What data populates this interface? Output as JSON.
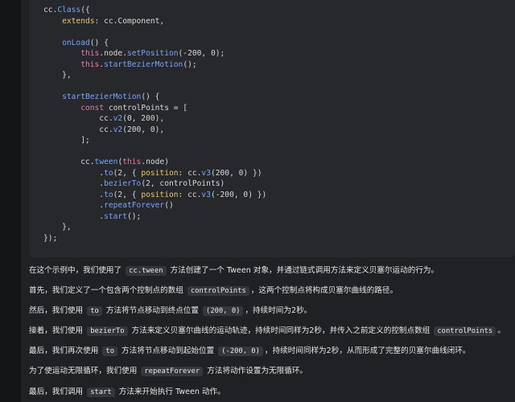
{
  "code": {
    "lines": [
      [
        {
          "t": "cc.",
          "c": "plain"
        },
        {
          "t": "Class",
          "c": "fn"
        },
        {
          "t": "({",
          "c": "plain"
        }
      ],
      [
        {
          "t": "    ",
          "c": "plain"
        },
        {
          "t": "extends",
          "c": "prop"
        },
        {
          "t": ": cc.Component,",
          "c": "plain"
        }
      ],
      [
        {
          "t": "",
          "c": "plain"
        }
      ],
      [
        {
          "t": "    ",
          "c": "plain"
        },
        {
          "t": "onLoad",
          "c": "fn"
        },
        {
          "t": "() {",
          "c": "plain"
        }
      ],
      [
        {
          "t": "        ",
          "c": "plain"
        },
        {
          "t": "this",
          "c": "kw"
        },
        {
          "t": ".node.",
          "c": "plain"
        },
        {
          "t": "setPosition",
          "c": "fn"
        },
        {
          "t": "(-200, 0);",
          "c": "plain"
        }
      ],
      [
        {
          "t": "        ",
          "c": "plain"
        },
        {
          "t": "this",
          "c": "kw"
        },
        {
          "t": ".",
          "c": "plain"
        },
        {
          "t": "startBezierMotion",
          "c": "fn"
        },
        {
          "t": "();",
          "c": "plain"
        }
      ],
      [
        {
          "t": "    },",
          "c": "plain"
        }
      ],
      [
        {
          "t": "",
          "c": "plain"
        }
      ],
      [
        {
          "t": "    ",
          "c": "plain"
        },
        {
          "t": "startBezierMotion",
          "c": "fn"
        },
        {
          "t": "() {",
          "c": "plain"
        }
      ],
      [
        {
          "t": "        ",
          "c": "plain"
        },
        {
          "t": "const",
          "c": "kw"
        },
        {
          "t": " controlPoints = [",
          "c": "plain"
        }
      ],
      [
        {
          "t": "            cc.",
          "c": "plain"
        },
        {
          "t": "v2",
          "c": "fn"
        },
        {
          "t": "(0, 200),",
          "c": "plain"
        }
      ],
      [
        {
          "t": "            cc.",
          "c": "plain"
        },
        {
          "t": "v2",
          "c": "fn"
        },
        {
          "t": "(200, 0),",
          "c": "plain"
        }
      ],
      [
        {
          "t": "        ];",
          "c": "plain"
        }
      ],
      [
        {
          "t": "",
          "c": "plain"
        }
      ],
      [
        {
          "t": "        cc.",
          "c": "plain"
        },
        {
          "t": "tween",
          "c": "fn"
        },
        {
          "t": "(",
          "c": "plain"
        },
        {
          "t": "this",
          "c": "kw"
        },
        {
          "t": ".node)",
          "c": "plain"
        }
      ],
      [
        {
          "t": "            .",
          "c": "plain"
        },
        {
          "t": "to",
          "c": "fn"
        },
        {
          "t": "(2, { ",
          "c": "plain"
        },
        {
          "t": "position",
          "c": "prop"
        },
        {
          "t": ": cc.",
          "c": "plain"
        },
        {
          "t": "v3",
          "c": "fn"
        },
        {
          "t": "(200, 0) })",
          "c": "plain"
        }
      ],
      [
        {
          "t": "            .",
          "c": "plain"
        },
        {
          "t": "bezierTo",
          "c": "fn"
        },
        {
          "t": "(2, controlPoints)",
          "c": "plain"
        }
      ],
      [
        {
          "t": "            .",
          "c": "plain"
        },
        {
          "t": "to",
          "c": "fn"
        },
        {
          "t": "(2, { ",
          "c": "plain"
        },
        {
          "t": "position",
          "c": "prop"
        },
        {
          "t": ": cc.",
          "c": "plain"
        },
        {
          "t": "v3",
          "c": "fn"
        },
        {
          "t": "(-200, 0) })",
          "c": "plain"
        }
      ],
      [
        {
          "t": "            .",
          "c": "plain"
        },
        {
          "t": "repeatForever",
          "c": "fn"
        },
        {
          "t": "()",
          "c": "plain"
        }
      ],
      [
        {
          "t": "            .",
          "c": "plain"
        },
        {
          "t": "start",
          "c": "fn"
        },
        {
          "t": "();",
          "c": "plain"
        }
      ],
      [
        {
          "t": "    },",
          "c": "plain"
        }
      ],
      [
        {
          "t": "});",
          "c": "plain"
        }
      ]
    ]
  },
  "paragraphs": [
    [
      {
        "t": "在这个示例中，我们使用了 "
      },
      {
        "code": "cc.tween"
      },
      {
        "t": " 方法创建了一个 Tween 对象，并通过链式调用方法来定义贝塞尔运动的行为。"
      }
    ],
    [
      {
        "t": "首先，我们定义了一个包含两个控制点的数组 "
      },
      {
        "code": "controlPoints"
      },
      {
        "t": "，这两个控制点将构成贝塞尔曲线的路径。"
      }
    ],
    [
      {
        "t": "然后，我们使用 "
      },
      {
        "code": "to"
      },
      {
        "t": " 方法将节点移动到终点位置 "
      },
      {
        "code": "(200, 0)"
      },
      {
        "t": "，持续时间为2秒。"
      }
    ],
    [
      {
        "t": "接着，我们使用 "
      },
      {
        "code": "bezierTo"
      },
      {
        "t": " 方法来定义贝塞尔曲线的运动轨迹，持续时间同样为2秒，并传入之前定义的控制点数组 "
      },
      {
        "code": "controlPoints"
      },
      {
        "t": "。"
      }
    ],
    [
      {
        "t": "最后，我们再次使用 "
      },
      {
        "code": "to"
      },
      {
        "t": " 方法将节点移动到起始位置 "
      },
      {
        "code": "(-200, 0)"
      },
      {
        "t": "，持续时间同样为2秒，从而形成了完整的贝塞尔曲线闭环。"
      }
    ],
    [
      {
        "t": "为了使运动无限循环，我们使用 "
      },
      {
        "code": "repeatForever"
      },
      {
        "t": " 方法将动作设置为无限循环。"
      }
    ],
    [
      {
        "t": "最后，我们调用 "
      },
      {
        "code": "start"
      },
      {
        "t": " 方法来开始执行 Tween 动作。"
      }
    ]
  ]
}
